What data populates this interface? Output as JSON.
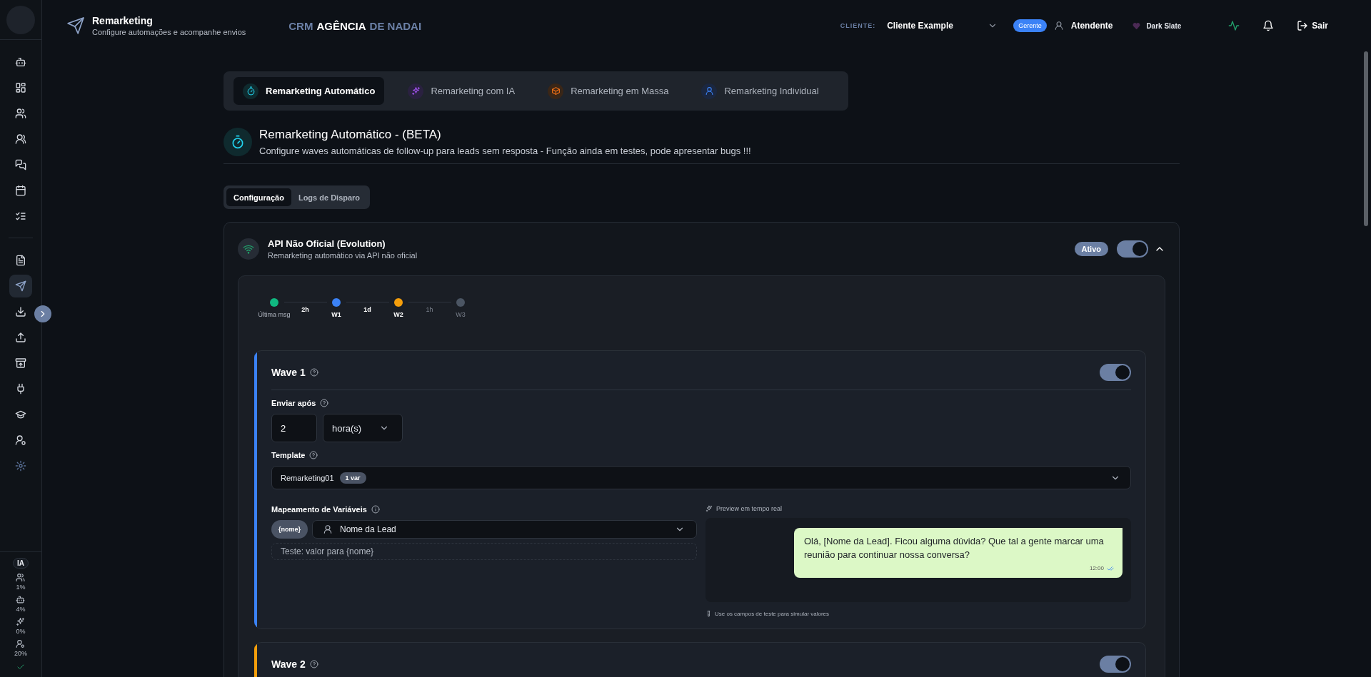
{
  "sidebar": {
    "nav_primary": [
      {
        "kind": "bot",
        "selected": false
      },
      {
        "kind": "grid",
        "selected": false
      },
      {
        "kind": "users",
        "selected": false
      },
      {
        "kind": "contacts",
        "selected": false
      },
      {
        "kind": "chat",
        "selected": false
      },
      {
        "kind": "calendar",
        "selected": false
      },
      {
        "kind": "checklist",
        "selected": false
      }
    ],
    "nav_secondary": [
      {
        "kind": "file",
        "selected": false
      },
      {
        "kind": "send",
        "selected": true
      },
      {
        "kind": "download",
        "selected": false
      },
      {
        "kind": "upload",
        "selected": false
      },
      {
        "kind": "archive",
        "selected": false
      },
      {
        "kind": "plug",
        "selected": false
      },
      {
        "kind": "cap",
        "selected": false
      },
      {
        "kind": "usergear",
        "selected": false
      },
      {
        "kind": "gear",
        "selected": false
      }
    ],
    "usage_badge": "IA",
    "usage": [
      {
        "kind": "users",
        "value": "1%"
      },
      {
        "kind": "bot",
        "value": "4%"
      },
      {
        "kind": "sparkles",
        "value": "0%"
      },
      {
        "kind": "usergear",
        "value": "20%"
      }
    ]
  },
  "header": {
    "title": "Remarketing",
    "subtitle": "Configure automações e acompanhe envios",
    "brand": [
      {
        "text": "CRM",
        "highlight": false
      },
      {
        "text": "AGÊNCIA",
        "highlight": true
      },
      {
        "text": "DE NADAI",
        "highlight": false
      }
    ],
    "client_label": "CLIENTE:",
    "client": "Cliente Example",
    "role": "Gerente",
    "user": "Atendente",
    "theme": "Dark Slate",
    "logout": "Sair"
  },
  "tabs": [
    {
      "kind": "timer",
      "label": "Remarketing Automático",
      "selected": true
    },
    {
      "kind": "sparkles",
      "label": "Remarketing com IA",
      "selected": false
    },
    {
      "kind": "box",
      "label": "Remarketing em Massa",
      "selected": false
    },
    {
      "kind": "user",
      "label": "Remarketing Individual",
      "selected": false
    }
  ],
  "section": {
    "title": "Remarketing Automático - (BETA)",
    "description": "Configure waves automáticas de follow-up para leads sem resposta - Função ainda em testes, pode apresentar bugs !!!"
  },
  "subtabs": [
    {
      "label": "Configuração",
      "selected": true
    },
    {
      "label": "Logs de Disparo",
      "selected": false
    }
  ],
  "api": {
    "title": "API Não Oficial (Evolution)",
    "subtitle": "Remarketing automático via API não oficial",
    "status": "Ativo",
    "on": true,
    "expanded": true,
    "timeline": [
      {
        "label": "Última msg",
        "color": "#10b981",
        "disabled": false
      },
      {
        "label": "W1",
        "color": "#3b82f6",
        "disabled": false
      },
      {
        "label": "W2",
        "color": "#f59e0b",
        "disabled": false
      },
      {
        "label": "W3",
        "color": "#4b5563",
        "disabled": true
      }
    ],
    "intervals": [
      {
        "text": "2h",
        "disabled": false
      },
      {
        "text": "1d",
        "disabled": false
      },
      {
        "text": "1h",
        "disabled": true
      }
    ],
    "waves": [
      {
        "title": "Wave 1",
        "on": true,
        "color": "#3b82f6",
        "fields": {
          "delay_label": "Enviar após",
          "delay_value": "2",
          "delay_unit": "hora(s)",
          "template_label": "Template",
          "template": "Remarketing01",
          "template_badge": "1 var",
          "mapping_label": "Mapeamento de Variáveis",
          "variables": [
            {
              "name": "{nome}",
              "source": "Nome da Lead",
              "test_placeholder": "Teste: valor para {nome}"
            }
          ],
          "preview_label": "Preview em tempo real",
          "message": "Olá, [Nome da Lead]. Ficou alguma dúvida? Que tal a gente marcar uma reunião para continuar nossa conversa?",
          "time": "12:00",
          "hint": "Use os campos de teste para simular valores"
        }
      },
      {
        "title": "Wave 2",
        "on": true,
        "color": "#f59e0b"
      }
    ]
  }
}
